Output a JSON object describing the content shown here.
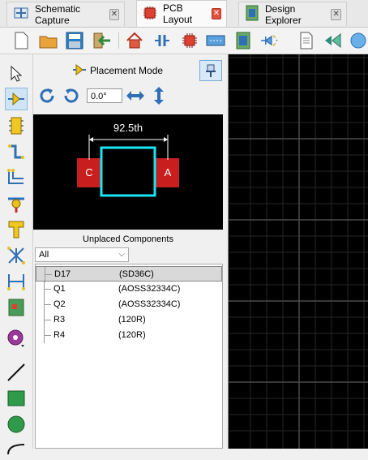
{
  "tabs": [
    {
      "label": "Schematic Capture",
      "icon": "schematic-icon",
      "active": false
    },
    {
      "label": "PCB Layout",
      "icon": "pcb-chip-icon",
      "active": true
    },
    {
      "label": "Design Explorer",
      "icon": "explorer-icon",
      "active": false
    }
  ],
  "toolbar_icons": [
    "new-file-icon",
    "open-folder-icon",
    "save-icon",
    "exit-icon",
    "home-icon",
    "component-icon",
    "chip-icon",
    "resistor-pack-icon",
    "board-icon",
    "route-icon",
    "document-icon",
    "3d-view-icon",
    "globe-icon"
  ],
  "left_tools": [
    "select-arrow-icon",
    "place-component-icon",
    "pad-icon",
    "track-icon",
    "bus-icon",
    "via-icon",
    "t-junction-icon",
    "ratsnest-icon",
    "dimension-icon",
    "board-edge-icon",
    "target-icon",
    "line-icon",
    "rectangle-icon",
    "circle-icon",
    "arc-icon"
  ],
  "panel": {
    "mode_label": "Placement Mode",
    "angle_value": "0.0°",
    "preview": {
      "dimension_label": "92.5th",
      "pad_left_label": "C",
      "pad_right_label": "A"
    },
    "unplaced_title": "Unplaced Components",
    "filter_value": "All",
    "components": [
      {
        "designator": "D17",
        "value": "(SD36C)",
        "selected": true
      },
      {
        "designator": "Q1",
        "value": "(AOSS32334C)",
        "selected": false
      },
      {
        "designator": "Q2",
        "value": "(AOSS32334C)",
        "selected": false
      },
      {
        "designator": "R3",
        "value": "(120R)",
        "selected": false
      },
      {
        "designator": "R4",
        "value": "(120R)",
        "selected": false
      }
    ]
  },
  "colors": {
    "pad_red": "#c81e1e",
    "outline_cyan": "#19e6f5",
    "grid_gray": "#3a3a3a",
    "canvas_bg": "#000000"
  }
}
